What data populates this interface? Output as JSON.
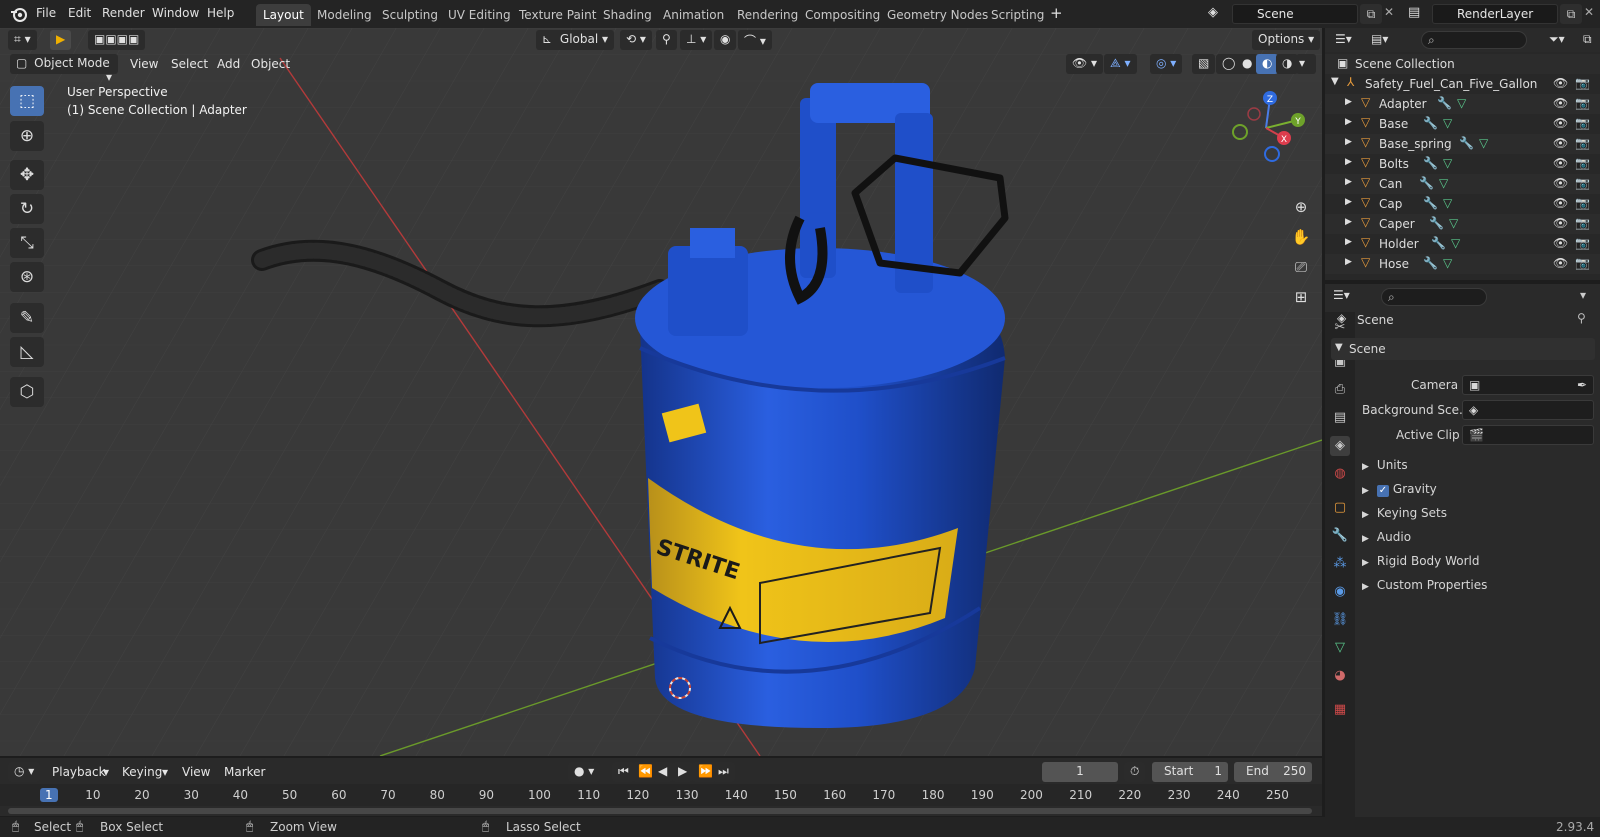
{
  "top_menu": [
    "File",
    "Edit",
    "Render",
    "Window",
    "Help"
  ],
  "workspaces": [
    "Layout",
    "Modeling",
    "Sculpting",
    "UV Editing",
    "Texture Paint",
    "Shading",
    "Animation",
    "Rendering",
    "Compositing",
    "Geometry Nodes",
    "Scripting"
  ],
  "active_workspace": "Layout",
  "scene_field": "Scene",
  "view_layer_field": "RenderLayer",
  "viewport": {
    "transform_orientation": "Global",
    "options_label": "Options",
    "mode": "Object Mode",
    "menus": [
      "View",
      "Select",
      "Add",
      "Object"
    ],
    "overlay_title": "User Perspective",
    "overlay_subtitle": "(1) Scene Collection | Adapter",
    "gizmo_axes": [
      "Z",
      "Y",
      "X"
    ]
  },
  "outliner": {
    "root": "Scene Collection",
    "collection": "Safety_Fuel_Can_Five_Gallon",
    "objects": [
      "Adapter",
      "Base",
      "Base_spring",
      "Bolts",
      "Can",
      "Cap",
      "Caper",
      "Holder",
      "Hose"
    ]
  },
  "properties": {
    "context_label": "Scene",
    "panel_title": "Scene",
    "fields": [
      {
        "label": "Camera"
      },
      {
        "label": "Background Sce..."
      },
      {
        "label": "Active Clip"
      }
    ],
    "sections": [
      "Units",
      "Gravity",
      "Keying Sets",
      "Audio",
      "Rigid Body World",
      "Custom Properties"
    ],
    "gravity_checked": true
  },
  "timeline": {
    "menus": [
      "Playback",
      "Keying",
      "View",
      "Marker"
    ],
    "current_frame": "1",
    "start_label": "Start",
    "start_value": "1",
    "end_label": "End",
    "end_value": "250",
    "ruler": [
      "1",
      "10",
      "20",
      "30",
      "40",
      "50",
      "60",
      "70",
      "80",
      "90",
      "100",
      "110",
      "120",
      "130",
      "140",
      "150",
      "160",
      "170",
      "180",
      "190",
      "200",
      "210",
      "220",
      "230",
      "240",
      "250"
    ]
  },
  "statusbar": {
    "select": "Select",
    "box_select": "Box Select",
    "zoom_view": "Zoom View",
    "lasso_select": "Lasso Select",
    "version": "2.93.4"
  },
  "colors": {
    "accent": "#4772b3",
    "can_blue": "#1f4fc9",
    "label_yellow": "#f0c419",
    "x_axis": "#b33a3a",
    "y_axis": "#6a9a2a",
    "object_orange": "#e59a3c"
  }
}
